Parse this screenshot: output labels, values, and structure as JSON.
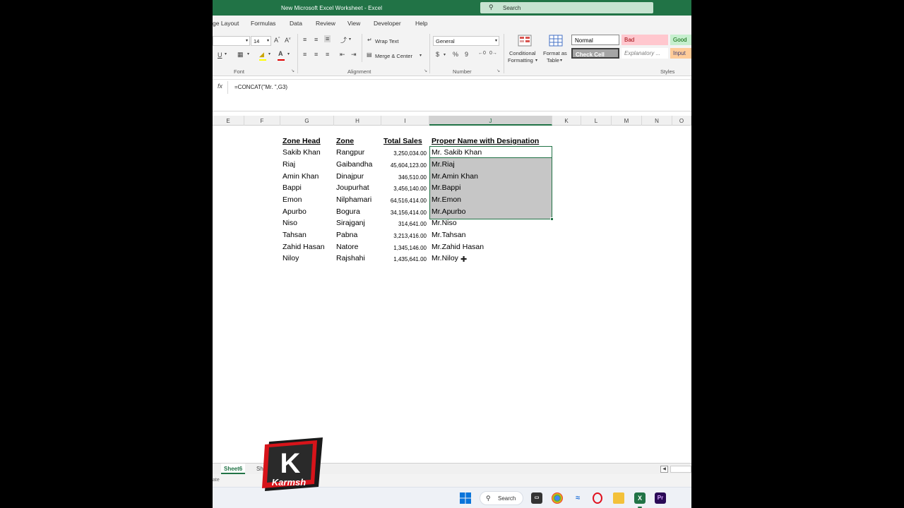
{
  "window": {
    "title": "New Microsoft Excel Worksheet  -  Excel",
    "search_label": "Search"
  },
  "menu": {
    "tabs": [
      "ge Layout",
      "Formulas",
      "Data",
      "Review",
      "View",
      "Developer",
      "Help"
    ]
  },
  "ribbon": {
    "font": {
      "name_partial": "",
      "size": "14",
      "group_label": "Font"
    },
    "alignment": {
      "wrap_text": "Wrap Text",
      "merge_center": "Merge & Center",
      "group_label": "Alignment"
    },
    "number": {
      "format": "General",
      "currency": "$",
      "percent": "%",
      "comma": "9",
      "group_label": "Number"
    },
    "styles": {
      "conditional_formatting": [
        "Conditional",
        "Formatting"
      ],
      "format_as_table": [
        "Format as",
        "Table"
      ],
      "normal": "Normal",
      "bad": "Bad",
      "good": "Good",
      "check_cell": "Check Cell",
      "explanatory": "Explanatory ...",
      "input": "Input",
      "group_label": "Styles"
    }
  },
  "formula_bar": {
    "fx": "fx",
    "formula": "=CONCAT(\"Mr. \",G3)"
  },
  "columns": [
    "E",
    "F",
    "G",
    "H",
    "I",
    "J",
    "K",
    "L",
    "M",
    "N",
    "O"
  ],
  "table": {
    "headers": [
      "Zone Head",
      "Zone",
      "Total Sales",
      "Proper Name with Designation"
    ],
    "rows": [
      [
        "Sakib Khan",
        "Rangpur",
        "3,250,034.00",
        "Mr. Sakib Khan"
      ],
      [
        "Riaj",
        "Gaibandha",
        "45,604,123.00",
        "Mr.Riaj"
      ],
      [
        "Amin Khan",
        "Dinajpur",
        "346,510.00",
        "Mr.Amin Khan"
      ],
      [
        "Bappi",
        "Joupurhat",
        "3,456,140.00",
        "Mr.Bappi"
      ],
      [
        "Emon",
        "Nilphamari",
        "64,516,414.00",
        "Mr.Emon"
      ],
      [
        "Apurbo",
        "Bogura",
        "34,156,414.00",
        "Mr.Apurbo"
      ],
      [
        "Niso",
        "Sirajganj",
        "314,641.00",
        "Mr.Niso"
      ],
      [
        "Tahsan",
        "Pabna",
        "3,213,416.00",
        "Mr.Tahsan"
      ],
      [
        "Zahid Hasan",
        "Natore",
        "1,345,146.00",
        "Mr.Zahid Hasan"
      ],
      [
        "Niloy",
        "Rajshahi",
        "1,435,641.00",
        "Mr.Niloy"
      ]
    ]
  },
  "sheets": {
    "active": "Sheet6",
    "next_partial": "Sh"
  },
  "status": {
    "text": "ate"
  },
  "taskbar": {
    "search_label": "Search"
  },
  "logo": {
    "letter": "K",
    "text": "Karmsh"
  },
  "colors": {
    "excel_green": "#217346",
    "selection_gray": "#c6c6c6",
    "bad_bg": "#ffc7ce",
    "good_bg": "#c6efce",
    "input_bg": "#ffcc99"
  }
}
